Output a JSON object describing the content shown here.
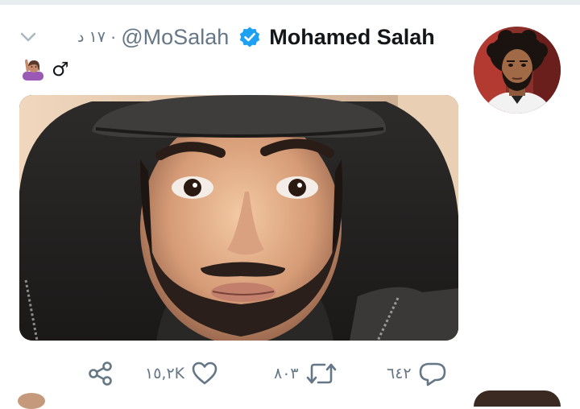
{
  "tweet": {
    "display_name": "Mohamed Salah",
    "handle": "@MoSalah",
    "separator": "·",
    "timestamp": "١٧ د",
    "verified": true,
    "bio_emoji": "person-raising-hand",
    "bio_symbol": "♂",
    "actions": {
      "share": {
        "icon": "share-icon"
      },
      "like": {
        "icon": "heart-icon",
        "count": "١٥,٢K"
      },
      "retweet": {
        "icon": "retweet-icon",
        "count": "٨٠٣"
      },
      "reply": {
        "icon": "reply-icon",
        "count": "٦٤٢"
      }
    }
  },
  "colors": {
    "verified_badge": "#1da1f2",
    "secondary_text": "#657786",
    "primary_text": "#14171a",
    "divider": "#e6ecf0"
  }
}
